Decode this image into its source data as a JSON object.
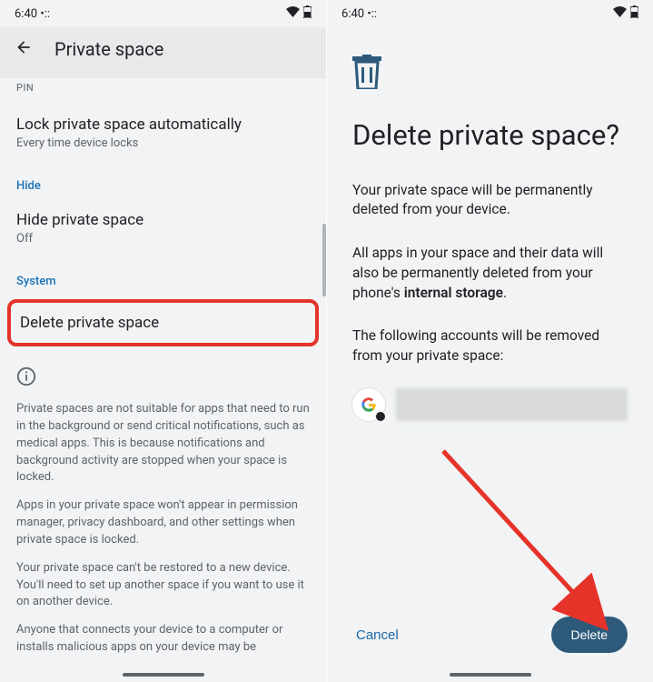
{
  "statusbar": {
    "time": "6:40",
    "dots": "•::"
  },
  "left": {
    "header_title": "Private space",
    "pin_cutoff": "PIN",
    "lock": {
      "title": "Lock private space automatically",
      "subtitle": "Every time device locks"
    },
    "section_hide": "Hide",
    "hide": {
      "title": "Hide private space",
      "subtitle": "Off"
    },
    "section_system": "System",
    "delete_item": "Delete private space",
    "info1": "Private spaces are not suitable for apps that need to run in the background or send critical notifications, such as medical apps. This is because notifications and background activity are stopped when your space is locked.",
    "info2": "Apps in your private space won't appear in permission manager, privacy dashboard, and other settings when private space is locked.",
    "info3": "Your private space can't be restored to a new device. You'll need to set up another space if you want to use it on another device.",
    "info4": "Anyone that connects your device to a computer or installs malicious apps on your device may be"
  },
  "right": {
    "title": "Delete private space?",
    "body1": "Your private space will be permanently deleted from your device.",
    "body2_pre": "All apps in your space and their data will also be permanently deleted from your phone's ",
    "body2_strong": "internal storage",
    "body2_post": ".",
    "body3": "The following accounts will be removed from your private space:",
    "cancel": "Cancel",
    "delete": "Delete"
  }
}
